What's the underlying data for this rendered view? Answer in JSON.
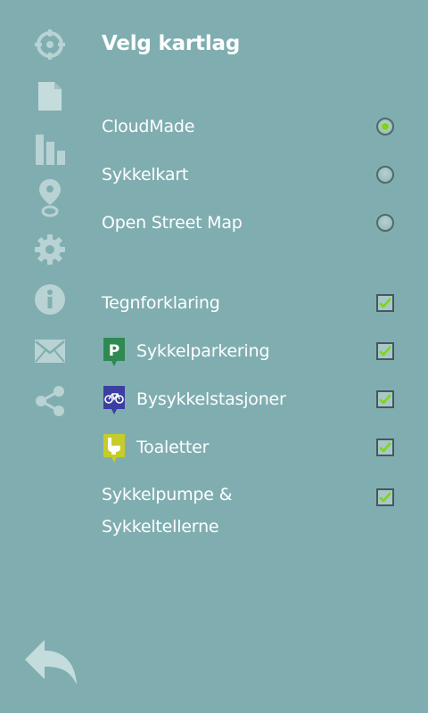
{
  "title": "Velg kartlag",
  "sidebar": {
    "icons": [
      "locate-icon",
      "document-icon",
      "bar-chart-icon",
      "map-pin-icon",
      "settings-gear-icon",
      "info-icon",
      "mail-icon",
      "share-icon"
    ]
  },
  "map_layers": [
    {
      "label": "CloudMade",
      "selected": true
    },
    {
      "label": "Sykkelkart",
      "selected": false
    },
    {
      "label": "Open Street Map",
      "selected": false
    }
  ],
  "overlays": [
    {
      "label": "Tegnforklaring",
      "checked": true
    },
    {
      "label": "Sykkelparkering",
      "checked": true,
      "badge": "P",
      "badge_color": "#2f8a52"
    },
    {
      "label": "Bysykkelstasjoner",
      "checked": true,
      "badge": "bicycle-icon",
      "badge_color": "#3b3fa0"
    },
    {
      "label": "Toaletter",
      "checked": true,
      "badge": "toilet-icon",
      "badge_color": "#c6cc2a"
    }
  ],
  "pump_counter": {
    "line1": "Sykkelpumpe &",
    "line2": "Sykkeltellerne",
    "checked": true
  },
  "back": {
    "icon": "back-arrow-icon"
  },
  "colors": {
    "background": "#80aeb0",
    "icon": "#b9d2d3",
    "radio_selected": "#7ed321",
    "check": "#7ed321"
  }
}
